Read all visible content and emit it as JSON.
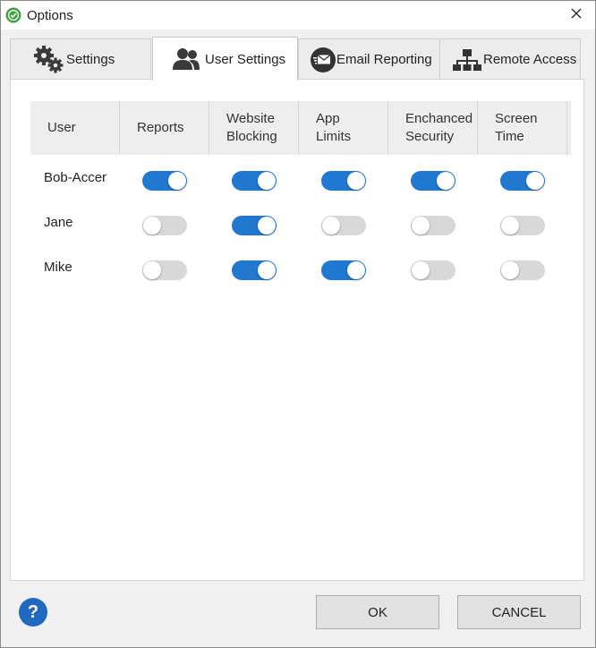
{
  "window": {
    "title": "Options",
    "accent": "#2078d0"
  },
  "tabs": [
    {
      "label": "Settings",
      "icon": "gears-icon",
      "active": false
    },
    {
      "label": "User Settings",
      "icon": "users-icon",
      "active": true
    },
    {
      "label": "Email Reporting",
      "icon": "email-icon",
      "active": false
    },
    {
      "label": "Remote Access",
      "icon": "network-icon",
      "active": false
    }
  ],
  "table": {
    "headers": [
      "User",
      "Reports",
      "Website\nBlocking",
      "App\nLimits",
      "Enchanced\nSecurity",
      "Screen\nTime"
    ],
    "rows": [
      {
        "user": "Bob-Accer",
        "toggles": [
          true,
          true,
          true,
          true,
          true
        ]
      },
      {
        "user": "Jane",
        "toggles": [
          false,
          true,
          false,
          false,
          false
        ]
      },
      {
        "user": "Mike",
        "toggles": [
          false,
          true,
          true,
          false,
          false
        ]
      }
    ]
  },
  "footer": {
    "help_label": "?",
    "ok_label": "OK",
    "cancel_label": "CANCEL"
  }
}
